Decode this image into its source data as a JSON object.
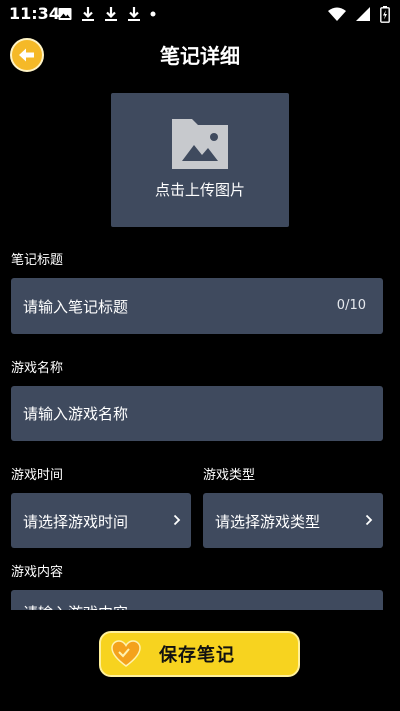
{
  "status_bar": {
    "time": "11:34",
    "icons_left": [
      "image-icon",
      "download-icon",
      "download-icon",
      "download-icon",
      "dot-icon"
    ],
    "icons_right": [
      "wifi-icon",
      "signal-icon",
      "battery-charging-icon"
    ]
  },
  "header": {
    "back_icon": "arrow-left-icon",
    "title": "笔记详细"
  },
  "upload": {
    "icon": "image-placeholder-icon",
    "label": "点击上传图片"
  },
  "form": {
    "note_title": {
      "label": "笔记标题",
      "placeholder": "请输入笔记标题",
      "counter": "0/10"
    },
    "game_name": {
      "label": "游戏名称",
      "placeholder": "请输入游戏名称"
    },
    "game_time": {
      "label": "游戏时间",
      "placeholder": "请选择游戏时间"
    },
    "game_type": {
      "label": "游戏类型",
      "placeholder": "请选择游戏类型"
    },
    "game_content": {
      "label": "游戏内容",
      "placeholder": "请输入游戏内容"
    }
  },
  "save": {
    "icon": "heart-icon",
    "label": "保存笔记"
  },
  "colors": {
    "background": "#000000",
    "field": "#3f4a5e",
    "accent_yellow": "#f7d31f",
    "back_orange": "#f5b928"
  }
}
